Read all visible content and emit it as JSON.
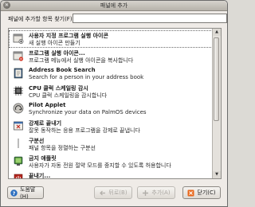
{
  "window": {
    "title": "패널에 추가"
  },
  "search": {
    "label": "패널에 추가할 항목 찾기(F):",
    "value": "",
    "placeholder": ""
  },
  "items": [
    {
      "icon": "custom-launcher-icon",
      "title": "사용자 지정 프로그램 실행 아이콘",
      "desc": "새 실행 아이콘 만들기"
    },
    {
      "icon": "app-launcher-icon",
      "title": "프로그램 실행 아이콘...",
      "desc": "프로그램 메뉴에서 실행 아이콘을 복사합니다"
    },
    {
      "icon": "address-book-icon",
      "title": "Address Book Search",
      "desc": "Search for a person in your address book"
    },
    {
      "icon": "cpu-monitor-icon",
      "title": "CPU 클럭 스케일링 감시",
      "desc": "CPU 클럭 스케일링을 감시합니다"
    },
    {
      "icon": "pilot-applet-icon",
      "title": "Pilot Applet",
      "desc": "Synchronize your data on PalmOS devices"
    },
    {
      "icon": "force-quit-icon",
      "title": "강제로 끝내기",
      "desc": "잘못 동작하는 응용 프로그램을 강제로 끝냅니다"
    },
    {
      "icon": "separator-icon",
      "title": "구분선",
      "desc": "패널 항목을 정렬하는 구분선"
    },
    {
      "icon": "inhibit-applet-icon",
      "title": "금지 애플릿",
      "desc": "사용자가 자동 전원 절약 모드를 중지할 수 있도록 허용합니다"
    },
    {
      "icon": "shutdown-icon",
      "title": "끝내기...",
      "desc": ""
    }
  ],
  "buttons": {
    "help": "도움말(H)",
    "back": "뒤로(B)",
    "add": "추가(A)",
    "close": "닫기(C)"
  },
  "colors": {
    "accent_close": "#e8661a",
    "help_blue": "#2c6fc0"
  }
}
